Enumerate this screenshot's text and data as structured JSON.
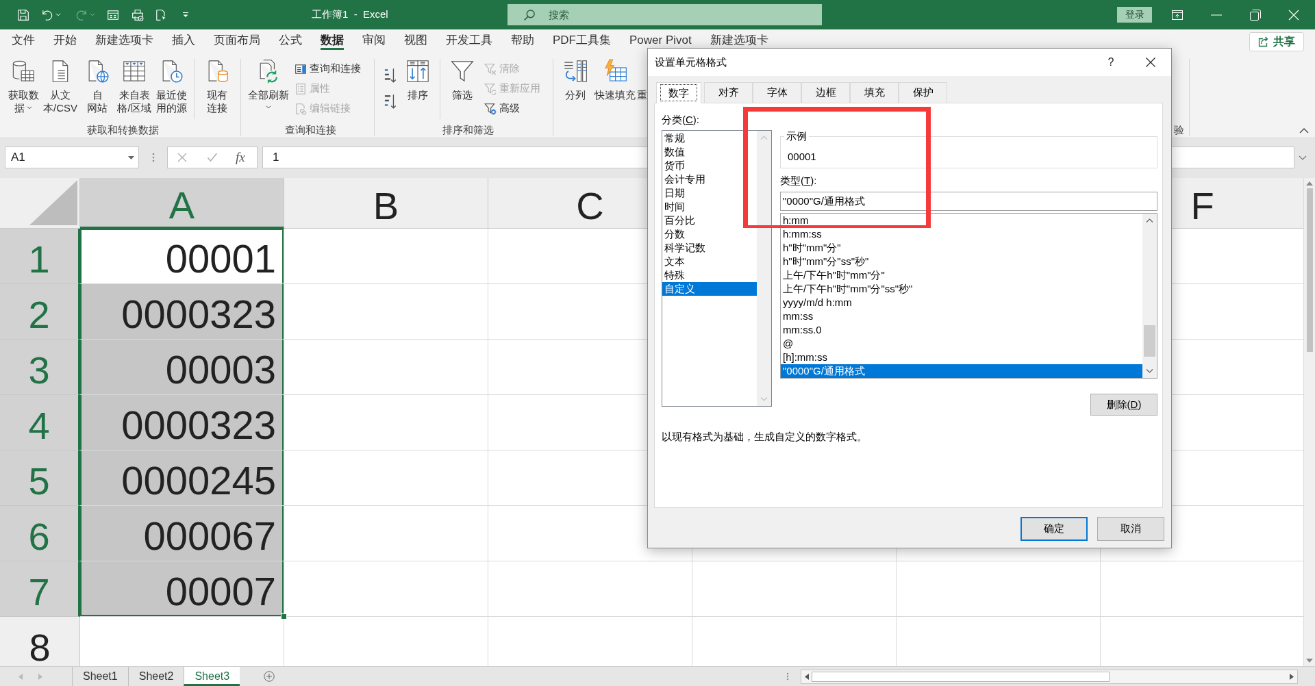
{
  "window": {
    "title": "工作簿1  -  Excel",
    "search_placeholder": "搜索",
    "sign_in": "登录"
  },
  "menu_tabs": [
    {
      "label": "文件",
      "selected": false
    },
    {
      "label": "开始",
      "selected": false
    },
    {
      "label": "新建选项卡",
      "selected": false
    },
    {
      "label": "插入",
      "selected": false
    },
    {
      "label": "页面布局",
      "selected": false
    },
    {
      "label": "公式",
      "selected": false
    },
    {
      "label": "数据",
      "selected": true
    },
    {
      "label": "审阅",
      "selected": false
    },
    {
      "label": "视图",
      "selected": false
    },
    {
      "label": "开发工具",
      "selected": false
    },
    {
      "label": "帮助",
      "selected": false
    },
    {
      "label": "PDF工具集",
      "selected": false
    },
    {
      "label": "Power Pivot",
      "selected": false
    },
    {
      "label": "新建选项卡",
      "selected": false
    }
  ],
  "share_button": "共享",
  "ribbon_groups": [
    {
      "label": "获取和转换数据",
      "items": [
        {
          "kind": "large",
          "lines": [
            "获取数",
            "据"
          ],
          "dropdown": true
        },
        {
          "kind": "large",
          "lines": [
            "从文",
            "本/CSV"
          ]
        },
        {
          "kind": "large",
          "lines": [
            "自",
            "网站"
          ]
        },
        {
          "kind": "large",
          "lines": [
            "来自表",
            "格/区域"
          ]
        },
        {
          "kind": "large",
          "lines": [
            "最近使",
            "用的源"
          ]
        },
        {
          "kind": "separator"
        },
        {
          "kind": "large",
          "lines": [
            "现有",
            "连接"
          ]
        }
      ]
    },
    {
      "label": "查询和连接",
      "items": [
        {
          "kind": "large",
          "lines": [
            "全部刷新"
          ],
          "dropdown": true
        },
        {
          "kind": "stack",
          "entries": [
            {
              "label": "查询和连接",
              "disabled": false
            },
            {
              "label": "属性",
              "disabled": true
            },
            {
              "label": "编辑链接",
              "disabled": true
            }
          ]
        }
      ]
    },
    {
      "label": "排序和筛选",
      "items": [
        {
          "kind": "stack",
          "entries": [
            {
              "disabled": false
            },
            {
              "disabled": false
            }
          ]
        },
        {
          "kind": "large",
          "lines": [
            "排序"
          ]
        },
        {
          "kind": "separator"
        },
        {
          "kind": "large",
          "lines": [
            "筛选"
          ]
        },
        {
          "kind": "stack",
          "entries": [
            {
              "label": "清除",
              "disabled": true
            },
            {
              "label": "重新应用",
              "disabled": true
            },
            {
              "label": "高级",
              "disabled": false
            }
          ]
        }
      ]
    },
    {
      "items": [
        {
          "kind": "large",
          "lines": [
            "分列"
          ]
        },
        {
          "kind": "large",
          "lines": [
            "快速填充"
          ]
        },
        {
          "kind": "clipped",
          "lines": [
            "重"
          ]
        }
      ]
    }
  ],
  "ribbon_clipped_group_label": "验",
  "formula_bar": {
    "name_box": "A1",
    "function_button": "fx",
    "formula": "1"
  },
  "columns": [
    {
      "label": "A",
      "selected": true
    },
    {
      "label": "B",
      "selected": false
    },
    {
      "label": "C",
      "selected": false
    },
    {
      "label": "F",
      "selected": false
    }
  ],
  "rows": [
    {
      "number": "1",
      "selected": true,
      "cells": [
        {
          "value": "00001",
          "selected": true,
          "active": true
        }
      ]
    },
    {
      "number": "2",
      "selected": true,
      "cells": [
        {
          "value": "0000323",
          "selected": true,
          "active": false
        }
      ]
    },
    {
      "number": "3",
      "selected": true,
      "cells": [
        {
          "value": "00003",
          "selected": true,
          "active": false
        }
      ]
    },
    {
      "number": "4",
      "selected": true,
      "cells": [
        {
          "value": "0000323",
          "selected": true,
          "active": false
        }
      ]
    },
    {
      "number": "5",
      "selected": true,
      "cells": [
        {
          "value": "0000245",
          "selected": true,
          "active": false
        }
      ]
    },
    {
      "number": "6",
      "selected": true,
      "cells": [
        {
          "value": "000067",
          "selected": true,
          "active": false
        }
      ]
    },
    {
      "number": "7",
      "selected": true,
      "cells": [
        {
          "value": "00007",
          "selected": true,
          "active": false
        }
      ]
    },
    {
      "number": "8",
      "selected": false
    }
  ],
  "sheet_tabs": [
    {
      "label": "Sheet1",
      "selected": false
    },
    {
      "label": "Sheet2",
      "selected": false
    },
    {
      "label": "Sheet3",
      "selected": true
    }
  ],
  "format_dialog": {
    "title": "设置单元格格式",
    "help": "?",
    "tabs": [
      {
        "label": "数字",
        "selected": true
      },
      {
        "label": "对齐",
        "selected": false
      },
      {
        "label": "字体",
        "selected": false
      },
      {
        "label": "边框",
        "selected": false
      },
      {
        "label": "填充",
        "selected": false
      },
      {
        "label": "保护",
        "selected": false
      }
    ],
    "category_label": {
      "before": "分类(",
      "key": "C",
      "after": "):"
    },
    "categories": [
      {
        "label": "常规",
        "selected": false
      },
      {
        "label": "数值",
        "selected": false
      },
      {
        "label": "货币",
        "selected": false
      },
      {
        "label": "会计专用",
        "selected": false
      },
      {
        "label": "日期",
        "selected": false
      },
      {
        "label": "时间",
        "selected": false
      },
      {
        "label": "百分比",
        "selected": false
      },
      {
        "label": "分数",
        "selected": false
      },
      {
        "label": "科学记数",
        "selected": false
      },
      {
        "label": "文本",
        "selected": false
      },
      {
        "label": "特殊",
        "selected": false
      },
      {
        "label": "自定义",
        "selected": true
      }
    ],
    "sample_label": "示例",
    "sample_value": "00001",
    "type_label": {
      "before": "类型(",
      "key": "T",
      "after": "):"
    },
    "type_value": "\"0000\"G/通用格式",
    "types": [
      {
        "label": "h:mm",
        "selected": false
      },
      {
        "label": "h:mm:ss",
        "selected": false
      },
      {
        "label": "h\"时\"mm\"分\"",
        "selected": false
      },
      {
        "label": "h\"时\"mm\"分\"ss\"秒\"",
        "selected": false
      },
      {
        "label": "上午/下午h\"时\"mm\"分\"",
        "selected": false
      },
      {
        "label": "上午/下午h\"时\"mm\"分\"ss\"秒\"",
        "selected": false
      },
      {
        "label": "yyyy/m/d h:mm",
        "selected": false
      },
      {
        "label": "mm:ss",
        "selected": false
      },
      {
        "label": "mm:ss.0",
        "selected": false
      },
      {
        "label": "@",
        "selected": false
      },
      {
        "label": "[h]:mm:ss",
        "selected": false
      },
      {
        "label": "\"0000\"G/通用格式",
        "selected": true
      }
    ],
    "delete_button": {
      "before": "删除(",
      "key": "D",
      "after": ")"
    },
    "description": "以现有格式为基础，生成自定义的数字格式。",
    "ok_button": "确定",
    "cancel_button": "取消"
  }
}
